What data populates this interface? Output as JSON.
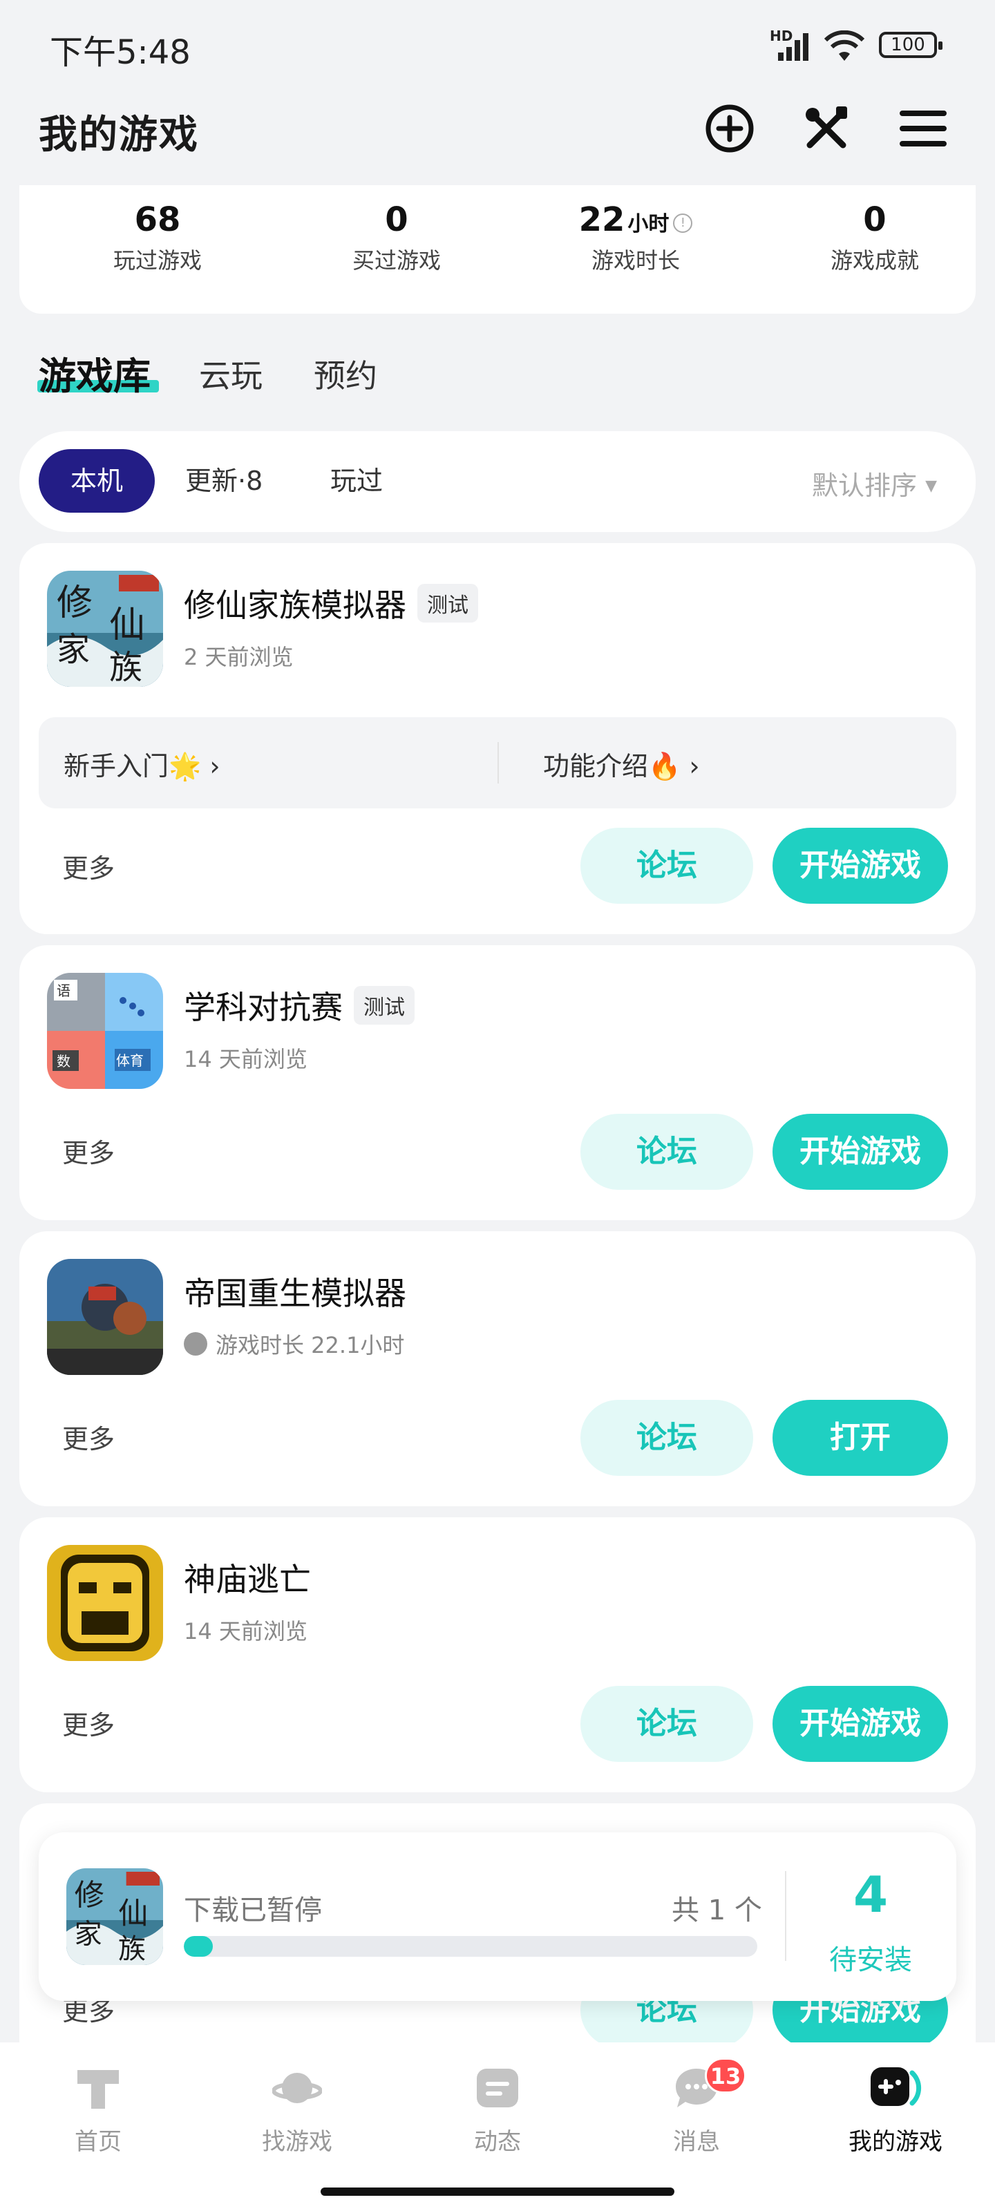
{
  "status_bar": {
    "time": "下午5:48",
    "network": "HD",
    "battery": "100"
  },
  "header": {
    "title": "我的游戏",
    "icons": [
      "add-circle-icon",
      "tools-icon",
      "menu-icon"
    ]
  },
  "stats": [
    {
      "value": "68",
      "unit": "",
      "label": "玩过游戏"
    },
    {
      "value": "0",
      "unit": "",
      "label": "买过游戏"
    },
    {
      "value": "22",
      "unit": "小时",
      "label": "游戏时长"
    },
    {
      "value": "0",
      "unit": "",
      "label": "游戏成就"
    }
  ],
  "main_tabs": [
    {
      "label": "游戏库",
      "active": true
    },
    {
      "label": "云玩"
    },
    {
      "label": "预约"
    }
  ],
  "filters": {
    "chips": [
      {
        "label": "本机",
        "active": true
      },
      {
        "label": "更新·8"
      },
      {
        "label": "玩过"
      }
    ],
    "sort": "默认排序"
  },
  "games": [
    {
      "name": "修仙家族模拟器",
      "badge": "测试",
      "sub": "2 天前浏览",
      "guide": [
        "新手入门🌟",
        "功能介绍🔥"
      ],
      "more": "更多",
      "forum": "论坛",
      "action": "开始游戏"
    },
    {
      "name": "学科对抗赛",
      "badge": "测试",
      "sub": "14 天前浏览",
      "more": "更多",
      "forum": "论坛",
      "action": "开始游戏"
    },
    {
      "name": "帝国重生模拟器",
      "badge": "",
      "sub": "游戏时长 22.1小时",
      "more": "更多",
      "forum": "论坛",
      "action": "打开"
    },
    {
      "name": "神庙逃亡",
      "badge": "",
      "sub": "14 天前浏览",
      "more": "更多",
      "forum": "论坛",
      "action": "开始游戏"
    },
    {
      "name": "",
      "badge": "",
      "sub": "",
      "more": "更多",
      "forum": "论坛",
      "action": "开始游戏"
    }
  ],
  "download": {
    "status": "下载已暂停",
    "count": "共 1 个",
    "progress": 0.05,
    "pending_count": "4",
    "pending_label": "待安装"
  },
  "bottom_nav": [
    {
      "label": "首页",
      "icon": "home-icon"
    },
    {
      "label": "找游戏",
      "icon": "planet-icon"
    },
    {
      "label": "动态",
      "icon": "feed-icon"
    },
    {
      "label": "消息",
      "icon": "message-icon",
      "badge": "13"
    },
    {
      "label": "我的游戏",
      "icon": "gamepad-icon",
      "active": true
    }
  ],
  "colors": {
    "accent": "#1fd0c2",
    "chip_active": "#231d86",
    "badge": "#ff4d4f"
  }
}
